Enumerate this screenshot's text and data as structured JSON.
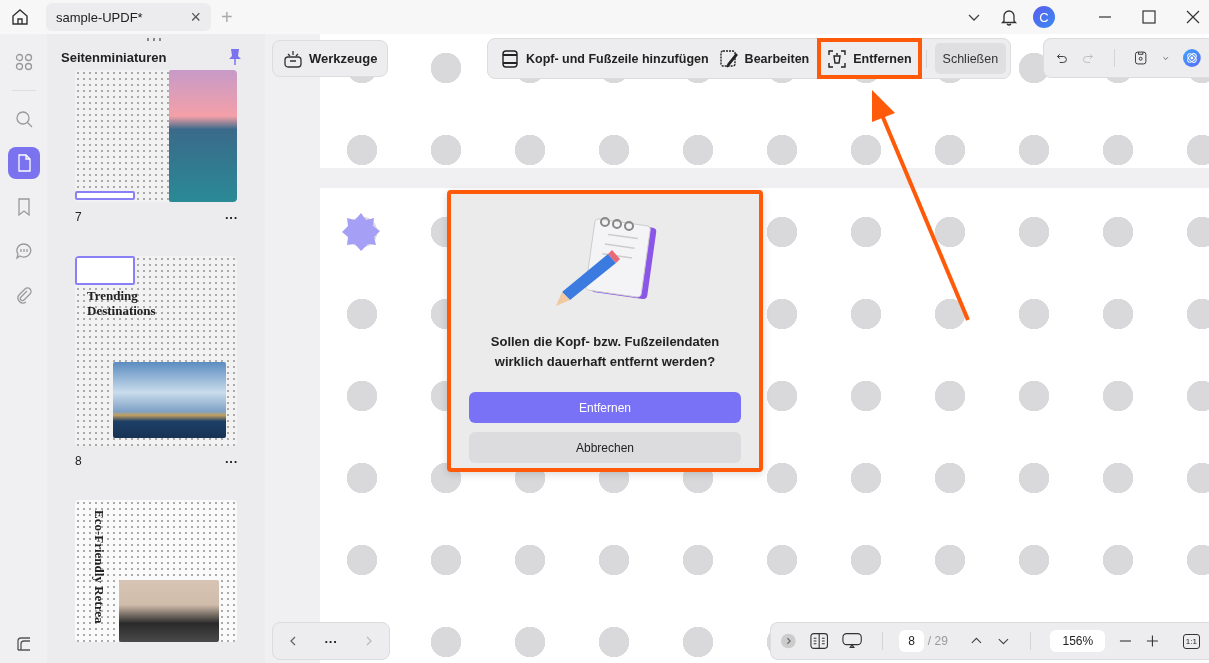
{
  "tab": {
    "title": "sample-UPDF*",
    "close": "×",
    "new": "+"
  },
  "user": {
    "initial": "C"
  },
  "rail": [
    {
      "selected": false
    },
    {
      "selected": false
    },
    {
      "selected": true
    },
    {
      "selected": false
    },
    {
      "selected": false
    },
    {
      "selected": false
    }
  ],
  "thumbnails": {
    "title": "Seitenminiaturen",
    "pages": [
      {
        "kind": "photo-right",
        "number": "7",
        "menu": "···"
      },
      {
        "kind": "title",
        "title": "Trending Destinations",
        "number": "8",
        "menu": "···"
      },
      {
        "kind": "vertical",
        "title": "Eco-Friendly Retrea"
      }
    ]
  },
  "tools_button": "Werkzeuge",
  "header_footer_toolbar": {
    "items": [
      {
        "label": "Kopf- und Fußzeile hinzufügen",
        "annotated": false
      },
      {
        "label": "Bearbeiten",
        "annotated": false
      },
      {
        "label": "Entfernen",
        "annotated": true
      }
    ],
    "close": "Schließen"
  },
  "dialog": {
    "message": "Sollen die Kopf- bzw. Fußzeilendaten wirklich dauerhaft entfernt werden?",
    "confirm": "Entfernen",
    "cancel": "Abbrechen",
    "annotated": true
  },
  "page_nav": {
    "more": "···"
  },
  "bottom_bar": {
    "page": "8",
    "total": "/ 29",
    "zoom": "156%",
    "actual_size": "1:1"
  }
}
